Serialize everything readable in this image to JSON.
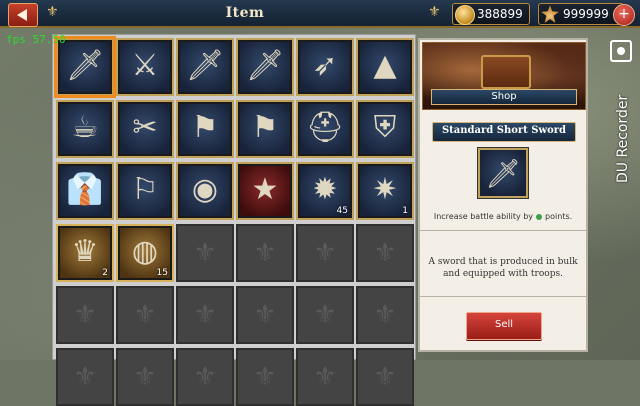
{
  "header": {
    "title": "Item",
    "gold": "388899",
    "medals": "999999",
    "plus_symbol": "+"
  },
  "debug": {
    "fps": "fps 57.50"
  },
  "grid": {
    "items": [
      {
        "icon": "sword-icon",
        "glyph": "🗡",
        "count": "",
        "style": "item",
        "selected": true
      },
      {
        "icon": "saber-icon",
        "glyph": "⚔",
        "count": "",
        "style": "item"
      },
      {
        "icon": "saber-icon",
        "glyph": "🗡",
        "count": "",
        "style": "item"
      },
      {
        "icon": "saber-icon",
        "glyph": "🗡",
        "count": "",
        "style": "item"
      },
      {
        "icon": "spear-icon",
        "glyph": "➶",
        "count": "",
        "style": "item"
      },
      {
        "icon": "cap-icon",
        "glyph": "▲",
        "count": "",
        "style": "item"
      },
      {
        "icon": "mug-icon",
        "glyph": "☕",
        "count": "",
        "style": "item"
      },
      {
        "icon": "pipes-icon",
        "glyph": "✂",
        "count": "",
        "style": "item"
      },
      {
        "icon": "flag-icon",
        "glyph": "⚑",
        "count": "",
        "style": "item"
      },
      {
        "icon": "flag-icon",
        "glyph": "⚑",
        "count": "",
        "style": "item"
      },
      {
        "icon": "helmet-icon",
        "glyph": "⛑",
        "count": "",
        "style": "item"
      },
      {
        "icon": "cuirass-icon",
        "glyph": "⛨",
        "count": "",
        "style": "item"
      },
      {
        "icon": "uniform-icon",
        "glyph": "👔",
        "count": "",
        "style": "item"
      },
      {
        "icon": "flag-icon",
        "glyph": "⚐",
        "count": "",
        "style": "item"
      },
      {
        "icon": "drum-icon",
        "glyph": "◉",
        "count": "",
        "style": "item"
      },
      {
        "icon": "star-medal-icon",
        "glyph": "★",
        "count": "",
        "style": "item red"
      },
      {
        "icon": "medal-icon",
        "glyph": "✹",
        "count": "45",
        "style": "item"
      },
      {
        "icon": "medal-icon",
        "glyph": "✷",
        "count": "1",
        "style": "item"
      },
      {
        "icon": "coin-icon",
        "glyph": "♛",
        "count": "2",
        "style": "item gold"
      },
      {
        "icon": "coin-icon",
        "glyph": "◍",
        "count": "15",
        "style": "item gold"
      }
    ],
    "empty_count": 16
  },
  "detail": {
    "shop_label": "Shop",
    "item_name": "Standard Short Sword",
    "preview_icon": "sword-icon",
    "ability_prefix": "Increase battle ability by",
    "ability_suffix": "points.",
    "description": "A sword that is produced in bulk and equipped with troops.",
    "sell_label": "Sell"
  },
  "overlay": {
    "recorder_text": "DU Recorder"
  }
}
